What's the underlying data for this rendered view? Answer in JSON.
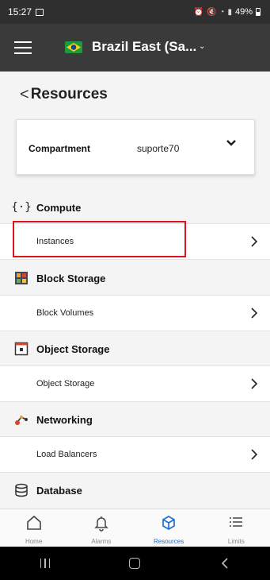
{
  "status_bar": {
    "time": "15:27",
    "battery": "49%"
  },
  "header": {
    "region": "Brazil East (Sa...",
    "region_flag": "brazil-flag-icon"
  },
  "page": {
    "back_label": "<",
    "title": "Resources"
  },
  "compartment": {
    "label": "Compartment",
    "value": "suporte70"
  },
  "sections": [
    {
      "icon": "compute-braces-icon",
      "label": "Compute",
      "items": [
        {
          "label": "Instances"
        }
      ]
    },
    {
      "icon": "block-storage-icon",
      "label": "Block Storage",
      "items": [
        {
          "label": "Block Volumes"
        }
      ]
    },
    {
      "icon": "object-storage-icon",
      "label": "Object Storage",
      "items": [
        {
          "label": "Object Storage"
        }
      ]
    },
    {
      "icon": "networking-icon",
      "label": "Networking",
      "items": [
        {
          "label": "Load Balancers"
        }
      ]
    },
    {
      "icon": "database-icon",
      "label": "Database",
      "items": []
    }
  ],
  "bottom_nav": [
    {
      "label": "Home",
      "icon": "home-icon",
      "active": false
    },
    {
      "label": "Alarms",
      "icon": "bell-icon",
      "active": false
    },
    {
      "label": "Resources",
      "icon": "cube-icon",
      "active": true
    },
    {
      "label": "Limits",
      "icon": "list-icon",
      "active": false
    }
  ],
  "colors": {
    "header_bg": "#3a3a3a",
    "accent": "#1f6fd1",
    "highlight": "#e0141e"
  }
}
